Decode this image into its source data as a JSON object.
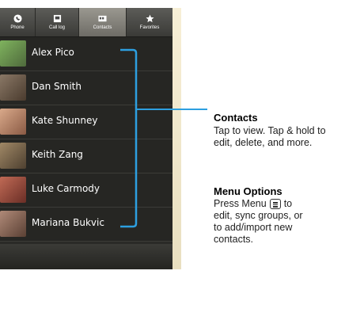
{
  "tabs": [
    {
      "label": "Phone",
      "icon": "phone-icon",
      "active": false
    },
    {
      "label": "Call log",
      "icon": "call-log-icon",
      "active": false
    },
    {
      "label": "Contacts",
      "icon": "contacts-icon",
      "active": true
    },
    {
      "label": "Favorites",
      "icon": "star-icon",
      "active": false
    }
  ],
  "contacts": [
    {
      "name": "Alex Pico",
      "avatar": "#5b8a4a"
    },
    {
      "name": "Dan Smith",
      "avatar": "#6f5a48"
    },
    {
      "name": "Kate Shunney",
      "avatar": "#b07c63"
    },
    {
      "name": "Keith Zang",
      "avatar": "#7a6a52"
    },
    {
      "name": "Luke Carmody",
      "avatar": "#9c4a3e"
    },
    {
      "name": "Mariana Bukvic",
      "avatar": "#8a6a5a"
    }
  ],
  "callouts": {
    "contacts_title": "Contacts",
    "contacts_line1": "Tap to view. Tap & hold to",
    "contacts_line2": "edit, delete, and more.",
    "menu_title": "Menu Options",
    "menu_line1_pre": "Press Menu",
    "menu_line1_post": "to",
    "menu_line2": "edit, sync groups, or",
    "menu_line3": "to add/import new",
    "menu_line4": "contacts."
  },
  "colors": {
    "callout_line": "#2d9fe0",
    "list_bg": "#262623",
    "strip_bg": "#f3ead0"
  }
}
